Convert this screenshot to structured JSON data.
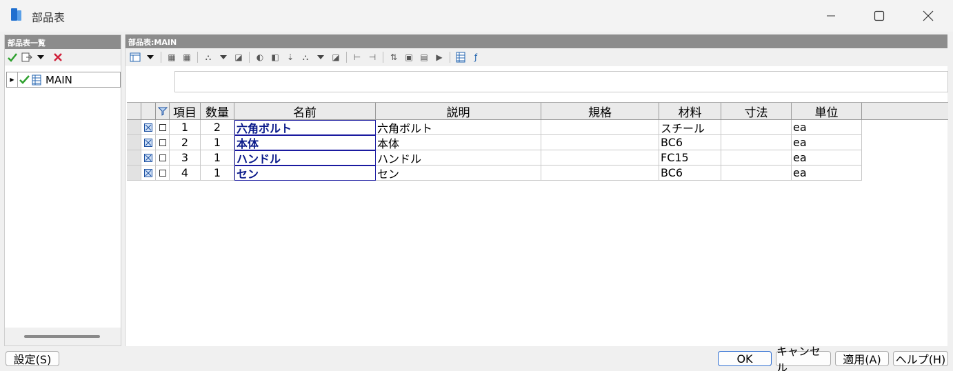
{
  "window": {
    "title": "部品表"
  },
  "left_panel": {
    "header": "部品表一覧",
    "tree": [
      {
        "label": "MAIN"
      }
    ]
  },
  "right_panel": {
    "header": "部品表:MAIN",
    "edit_value": ""
  },
  "table": {
    "columns": [
      "項目",
      "数量",
      "名前",
      "説明",
      "規格",
      "材料",
      "寸法",
      "単位"
    ],
    "rows": [
      {
        "item": "1",
        "qty": "2",
        "name": "六角ボルト",
        "desc": "六角ボルト",
        "spec": "",
        "material": "スチール",
        "dim": "",
        "unit": "ea"
      },
      {
        "item": "2",
        "qty": "1",
        "name": "本体",
        "desc": "本体",
        "spec": "",
        "material": "BC6",
        "dim": "",
        "unit": "ea"
      },
      {
        "item": "3",
        "qty": "1",
        "name": "ハンドル",
        "desc": "ハンドル",
        "spec": "",
        "material": "FC15",
        "dim": "",
        "unit": "ea"
      },
      {
        "item": "4",
        "qty": "1",
        "name": "セン",
        "desc": "セン",
        "spec": "",
        "material": "BC6",
        "dim": "",
        "unit": "ea"
      }
    ]
  },
  "buttons": {
    "settings": "設定(S)",
    "ok": "OK",
    "cancel": "キャンセル",
    "apply": "適用(A)",
    "help": "ヘルプ(H)"
  },
  "colors": {
    "accent": "#2a6bd0",
    "name_text": "#0a1a8a",
    "header_bg": "#8c8c8c"
  }
}
